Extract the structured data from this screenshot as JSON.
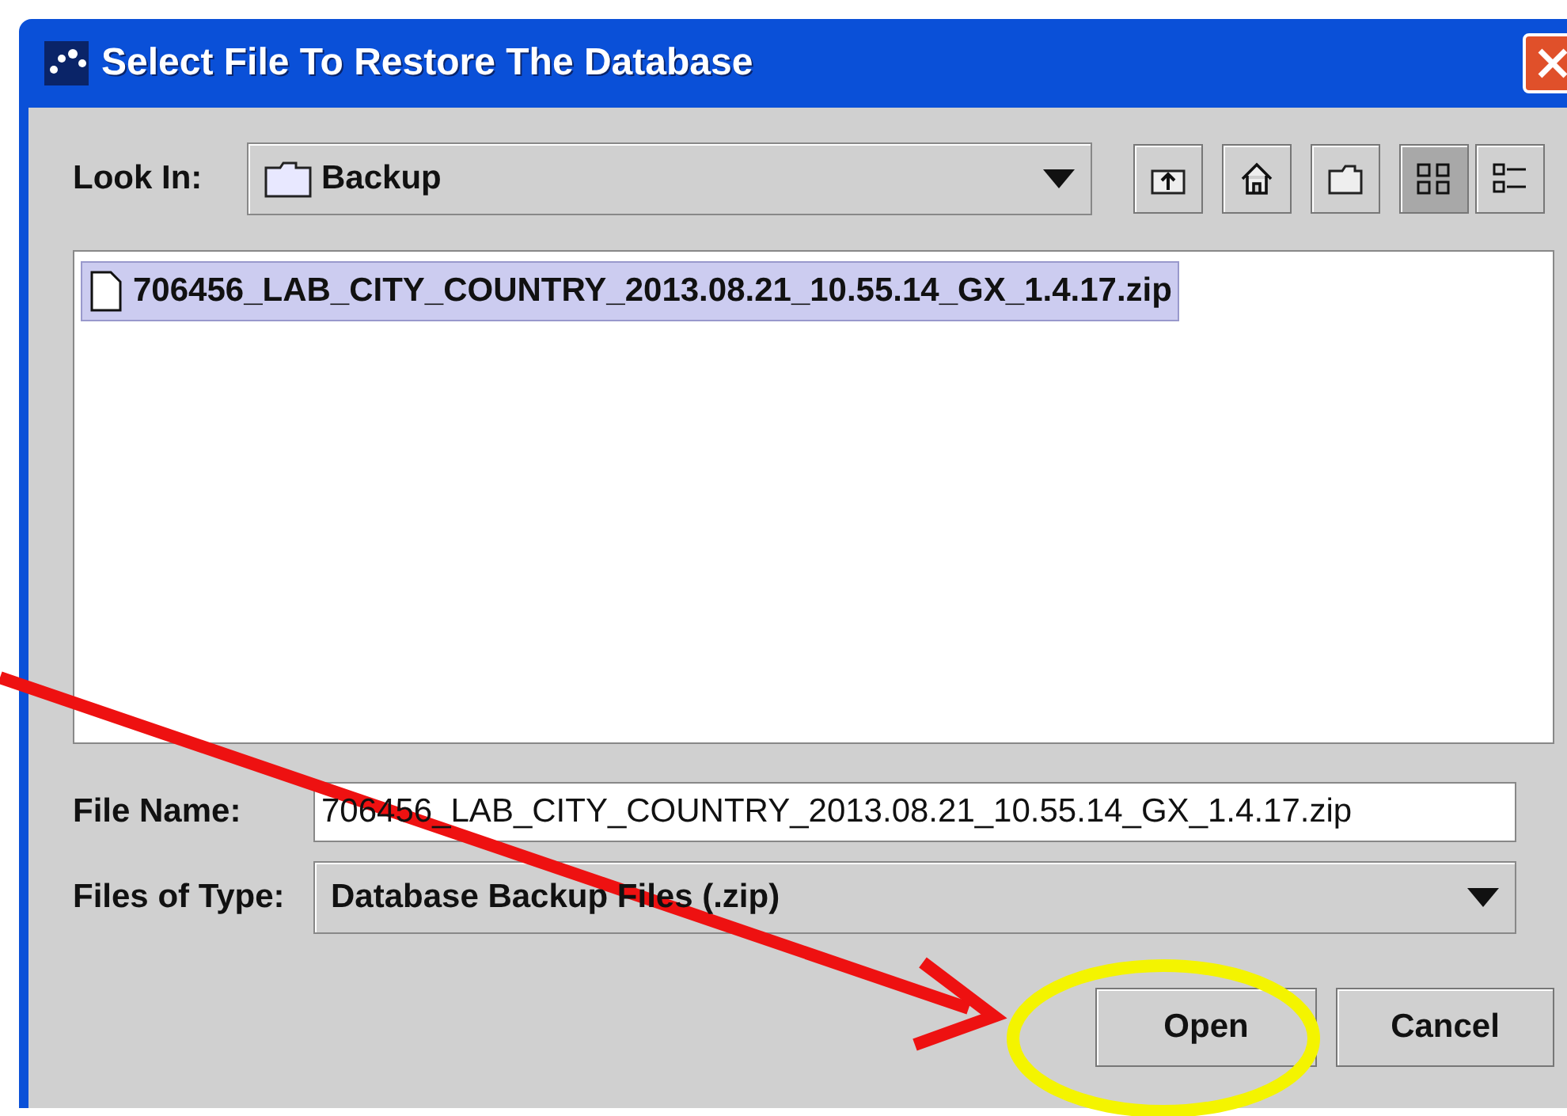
{
  "window": {
    "title": "Select File To Restore The Database"
  },
  "look_in": {
    "label": "Look In:",
    "value": "Backup"
  },
  "toolbar": [
    {
      "kind": "up",
      "selected": false
    },
    {
      "kind": "home",
      "selected": false
    },
    {
      "kind": "new-folder",
      "selected": false
    },
    {
      "kind": "list",
      "selected": true
    },
    {
      "kind": "details",
      "selected": false
    }
  ],
  "files": [
    {
      "name": "706456_LAB_CITY_COUNTRY_2013.08.21_10.55.14_GX_1.4.17.zip",
      "selected": true
    }
  ],
  "file_name": {
    "label": "File Name:",
    "value": "706456_LAB_CITY_COUNTRY_2013.08.21_10.55.14_GX_1.4.17.zip"
  },
  "file_type": {
    "label": "Files of Type:",
    "value": "Database Backup Files (.zip)"
  },
  "buttons": [
    {
      "label": "Open",
      "circled": true
    },
    {
      "label": "Cancel",
      "circled": false
    }
  ],
  "annotation": {
    "arrow": true
  }
}
